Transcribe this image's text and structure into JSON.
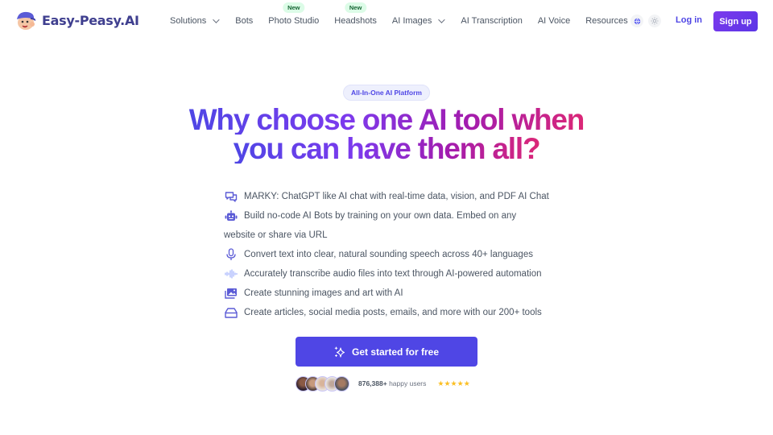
{
  "brand": {
    "name": "Easy-Peasy.AI"
  },
  "nav": {
    "items": [
      {
        "label": "Solutions",
        "dropdown": true,
        "badge": null
      },
      {
        "label": "Bots",
        "dropdown": false,
        "badge": null
      },
      {
        "label": "Photo Studio",
        "dropdown": false,
        "badge": "New"
      },
      {
        "label": "Headshots",
        "dropdown": false,
        "badge": "New"
      },
      {
        "label": "AI Images",
        "dropdown": true,
        "badge": null
      },
      {
        "label": "AI Transcription",
        "dropdown": false,
        "badge": null
      },
      {
        "label": "AI Voice",
        "dropdown": false,
        "badge": null
      },
      {
        "label": "Resources",
        "dropdown": true,
        "badge": null
      }
    ],
    "language_icon": "globe-icon",
    "theme_icon": "sun-icon",
    "login_label": "Log in",
    "signup_label": "Sign up"
  },
  "hero": {
    "pill": "All-In-One AI Platform",
    "headline_line1": "Why choose one AI tool when",
    "headline_line2": "you can have them all?",
    "features": [
      {
        "icon": "chat-icon",
        "text": "MARKY: ChatGPT like AI chat with real-time data, vision, and PDF AI Chat"
      },
      {
        "icon": "robot-icon",
        "text": "Build no-code AI Bots by training on your own data. Embed on any",
        "continuation": "website or share via URL"
      },
      {
        "icon": "microphone-icon",
        "text": "Convert text into clear, natural sounding speech across 40+ languages"
      },
      {
        "icon": "waveform-icon",
        "text": "Accurately transcribe audio files into text through AI-powered automation"
      },
      {
        "icon": "images-icon",
        "text": "Create stunning images and art with AI"
      },
      {
        "icon": "inbox-icon",
        "text": "Create articles, social media posts, emails, and more with our 200+ tools"
      }
    ],
    "cta_label": "Get started for free",
    "users_count": "876,388+",
    "users_suffix": "happy users",
    "rating_stars": 5
  },
  "colors": {
    "accent": "#4f46e5",
    "signup_gradient_start": "#7c3aed",
    "headline_gradient_end": "#db2777",
    "star": "#fbbf24",
    "badge_bg": "#dcfce7"
  }
}
